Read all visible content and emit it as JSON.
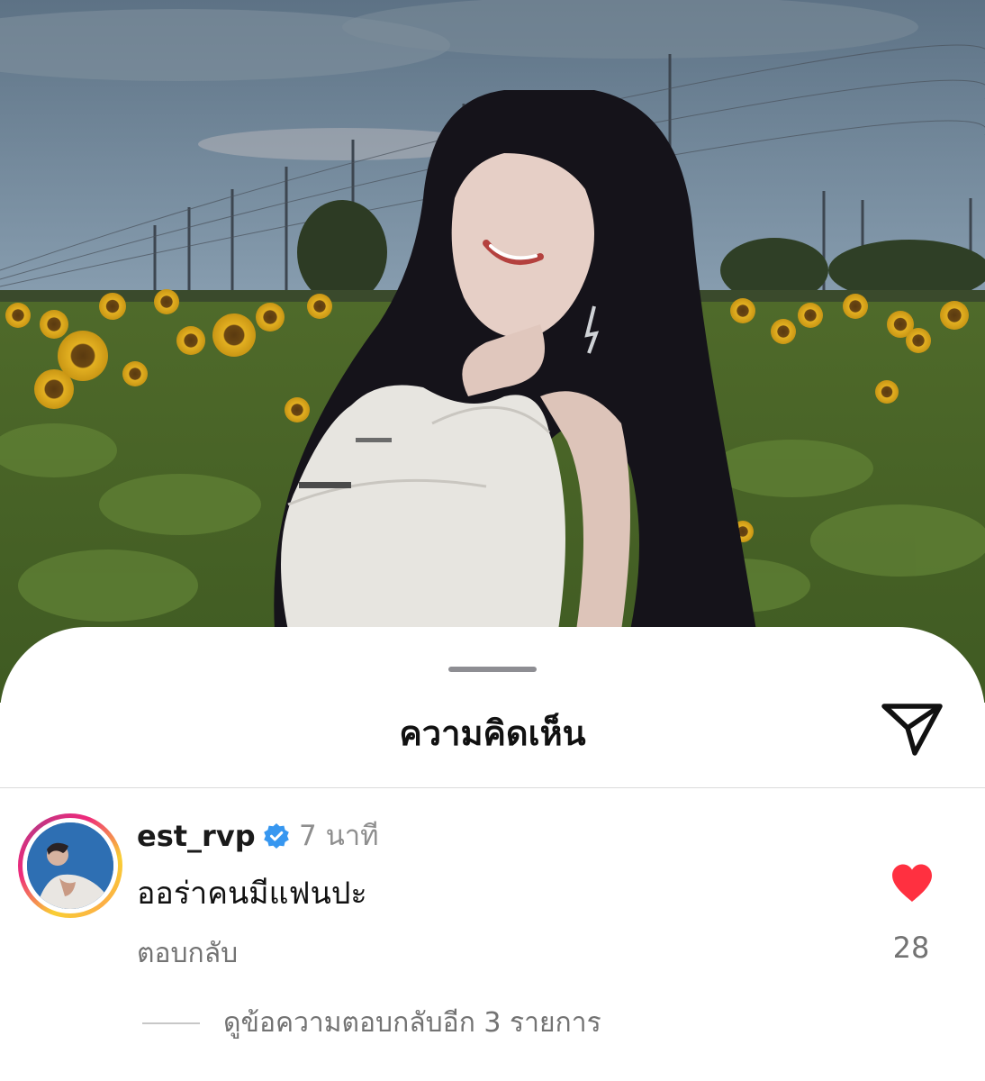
{
  "sheet": {
    "title": "ความคิดเห็น"
  },
  "comment": {
    "username": "est_rvp",
    "verified": true,
    "timestamp": "7 นาที",
    "text": "ออร่าคนมีแฟนปะ",
    "reply_label": "ตอบกลับ",
    "like_count": "28",
    "liked": true,
    "view_replies_label": "ดูข้อความตอบกลับอีก 3 รายการ"
  },
  "icons": {
    "share": "paper-plane-icon",
    "like": "heart-icon",
    "verified": "verified-badge-icon"
  },
  "colors": {
    "like_red": "#ff3040",
    "verified_blue": "#3797f0",
    "secondary_text": "#737373"
  }
}
